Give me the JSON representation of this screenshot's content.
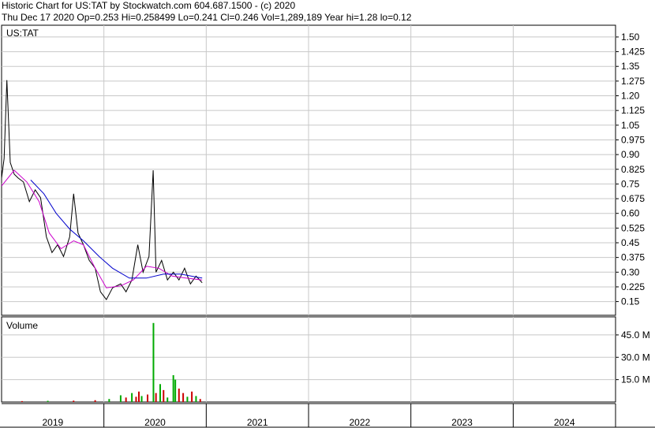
{
  "header": {
    "title_line": "Historic Chart for US:TAT by Stockwatch.com 604.687.1500 - (c) 2020",
    "quote_line": "Thu Dec 17 2020   Op=0.253   Hi=0.258499   Lo=0.241   Cl=0.246   Vol=1,289,189   Year hi=1.28   lo=0.12"
  },
  "chart_data": [
    {
      "type": "line",
      "title": "US:TAT",
      "ylim": [
        0.08,
        1.56
      ],
      "y_ticks": [
        "1.50",
        "1.425",
        "1.35",
        "1.275",
        "1.20",
        "1.125",
        "1.05",
        "0.975",
        "0.90",
        "0.825",
        "0.75",
        "0.675",
        "0.60",
        "0.525",
        "0.45",
        "0.375",
        "0.30",
        "0.225",
        "0.15"
      ],
      "x_ticks": [
        "2019",
        "2020",
        "2021",
        "2022",
        "2023",
        "2024"
      ],
      "xlim": [
        "2019-01-01",
        "2024-12-31"
      ],
      "grid": true,
      "series": [
        {
          "color": "#000000",
          "values": [
            {
              "x": "2019-01-01",
              "y": 0.78
            },
            {
              "x": "2019-01-10",
              "y": 0.88
            },
            {
              "x": "2019-01-20",
              "y": 1.28
            },
            {
              "x": "2019-02-01",
              "y": 0.86
            },
            {
              "x": "2019-02-15",
              "y": 0.8
            },
            {
              "x": "2019-03-01",
              "y": 0.78
            },
            {
              "x": "2019-03-20",
              "y": 0.76
            },
            {
              "x": "2019-04-10",
              "y": 0.66
            },
            {
              "x": "2019-05-01",
              "y": 0.72
            },
            {
              "x": "2019-05-20",
              "y": 0.68
            },
            {
              "x": "2019-06-10",
              "y": 0.48
            },
            {
              "x": "2019-06-30",
              "y": 0.4
            },
            {
              "x": "2019-07-20",
              "y": 0.44
            },
            {
              "x": "2019-08-10",
              "y": 0.38
            },
            {
              "x": "2019-09-01",
              "y": 0.48
            },
            {
              "x": "2019-09-15",
              "y": 0.7
            },
            {
              "x": "2019-10-01",
              "y": 0.5
            },
            {
              "x": "2019-10-20",
              "y": 0.44
            },
            {
              "x": "2019-11-10",
              "y": 0.36
            },
            {
              "x": "2019-12-01",
              "y": 0.32
            },
            {
              "x": "2019-12-20",
              "y": 0.2
            },
            {
              "x": "2020-01-10",
              "y": 0.16
            },
            {
              "x": "2020-02-01",
              "y": 0.22
            },
            {
              "x": "2020-03-01",
              "y": 0.24
            },
            {
              "x": "2020-03-20",
              "y": 0.2
            },
            {
              "x": "2020-04-10",
              "y": 0.26
            },
            {
              "x": "2020-05-01",
              "y": 0.44
            },
            {
              "x": "2020-05-20",
              "y": 0.3
            },
            {
              "x": "2020-06-10",
              "y": 0.38
            },
            {
              "x": "2020-06-25",
              "y": 0.82
            },
            {
              "x": "2020-07-05",
              "y": 0.3
            },
            {
              "x": "2020-07-25",
              "y": 0.36
            },
            {
              "x": "2020-08-15",
              "y": 0.26
            },
            {
              "x": "2020-09-05",
              "y": 0.3
            },
            {
              "x": "2020-09-25",
              "y": 0.26
            },
            {
              "x": "2020-10-15",
              "y": 0.32
            },
            {
              "x": "2020-11-05",
              "y": 0.24
            },
            {
              "x": "2020-11-25",
              "y": 0.28
            },
            {
              "x": "2020-12-17",
              "y": 0.246
            }
          ]
        },
        {
          "color": "#cc00cc",
          "values": [
            {
              "x": "2019-01-01",
              "y": 0.74
            },
            {
              "x": "2019-02-15",
              "y": 0.82
            },
            {
              "x": "2019-04-01",
              "y": 0.76
            },
            {
              "x": "2019-05-15",
              "y": 0.66
            },
            {
              "x": "2019-06-20",
              "y": 0.5
            },
            {
              "x": "2019-08-01",
              "y": 0.42
            },
            {
              "x": "2019-09-15",
              "y": 0.46
            },
            {
              "x": "2019-10-20",
              "y": 0.44
            },
            {
              "x": "2019-12-01",
              "y": 0.32
            },
            {
              "x": "2020-01-10",
              "y": 0.22
            },
            {
              "x": "2020-03-01",
              "y": 0.23
            },
            {
              "x": "2020-04-15",
              "y": 0.26
            },
            {
              "x": "2020-06-01",
              "y": 0.33
            },
            {
              "x": "2020-07-15",
              "y": 0.32
            },
            {
              "x": "2020-09-01",
              "y": 0.28
            },
            {
              "x": "2020-10-20",
              "y": 0.27
            },
            {
              "x": "2020-12-17",
              "y": 0.26
            }
          ]
        },
        {
          "color": "#0000cc",
          "values": [
            {
              "x": "2019-04-15",
              "y": 0.77
            },
            {
              "x": "2019-06-01",
              "y": 0.7
            },
            {
              "x": "2019-07-15",
              "y": 0.6
            },
            {
              "x": "2019-09-01",
              "y": 0.52
            },
            {
              "x": "2019-10-20",
              "y": 0.46
            },
            {
              "x": "2019-12-15",
              "y": 0.38
            },
            {
              "x": "2020-02-01",
              "y": 0.32
            },
            {
              "x": "2020-04-01",
              "y": 0.27
            },
            {
              "x": "2020-06-01",
              "y": 0.27
            },
            {
              "x": "2020-08-01",
              "y": 0.29
            },
            {
              "x": "2020-10-01",
              "y": 0.29
            },
            {
              "x": "2020-12-17",
              "y": 0.27
            }
          ]
        }
      ]
    },
    {
      "type": "bar",
      "title": "Volume",
      "ylim": [
        0,
        55
      ],
      "y_ticks": [
        "45.0 M",
        "30.0 M",
        "15.0 M"
      ],
      "x_ticks": [
        "2019",
        "2020",
        "2021",
        "2022",
        "2023",
        "2024"
      ],
      "bars": [
        {
          "x": "2019-03-15",
          "y": 0.6,
          "color": "#cc0000"
        },
        {
          "x": "2019-06-15",
          "y": 0.8,
          "color": "#00aa00"
        },
        {
          "x": "2019-09-15",
          "y": 0.9,
          "color": "#cc0000"
        },
        {
          "x": "2019-12-01",
          "y": 1.2,
          "color": "#cc0000"
        },
        {
          "x": "2020-01-20",
          "y": 2.0,
          "color": "#00aa00"
        },
        {
          "x": "2020-03-01",
          "y": 4.5,
          "color": "#00aa00"
        },
        {
          "x": "2020-03-20",
          "y": 3.0,
          "color": "#cc0000"
        },
        {
          "x": "2020-04-10",
          "y": 6.0,
          "color": "#00aa00"
        },
        {
          "x": "2020-04-25",
          "y": 3.5,
          "color": "#cc0000"
        },
        {
          "x": "2020-05-05",
          "y": 7.0,
          "color": "#cc0000"
        },
        {
          "x": "2020-05-15",
          "y": 4.0,
          "color": "#00aa00"
        },
        {
          "x": "2020-06-05",
          "y": 5.0,
          "color": "#cc0000"
        },
        {
          "x": "2020-06-26",
          "y": 53.0,
          "color": "#00aa00"
        },
        {
          "x": "2020-07-05",
          "y": 6.0,
          "color": "#cc0000"
        },
        {
          "x": "2020-07-20",
          "y": 12.0,
          "color": "#00aa00"
        },
        {
          "x": "2020-08-01",
          "y": 8.0,
          "color": "#cc0000"
        },
        {
          "x": "2020-08-15",
          "y": 3.0,
          "color": "#00aa00"
        },
        {
          "x": "2020-09-05",
          "y": 18.0,
          "color": "#00aa00"
        },
        {
          "x": "2020-09-12",
          "y": 15.0,
          "color": "#00aa00"
        },
        {
          "x": "2020-09-25",
          "y": 9.0,
          "color": "#cc0000"
        },
        {
          "x": "2020-10-10",
          "y": 6.0,
          "color": "#cc0000"
        },
        {
          "x": "2020-10-25",
          "y": 3.5,
          "color": "#00aa00"
        },
        {
          "x": "2020-11-10",
          "y": 7.0,
          "color": "#cc0000"
        },
        {
          "x": "2020-11-25",
          "y": 4.0,
          "color": "#00aa00"
        },
        {
          "x": "2020-12-10",
          "y": 2.0,
          "color": "#cc0000"
        }
      ]
    }
  ]
}
